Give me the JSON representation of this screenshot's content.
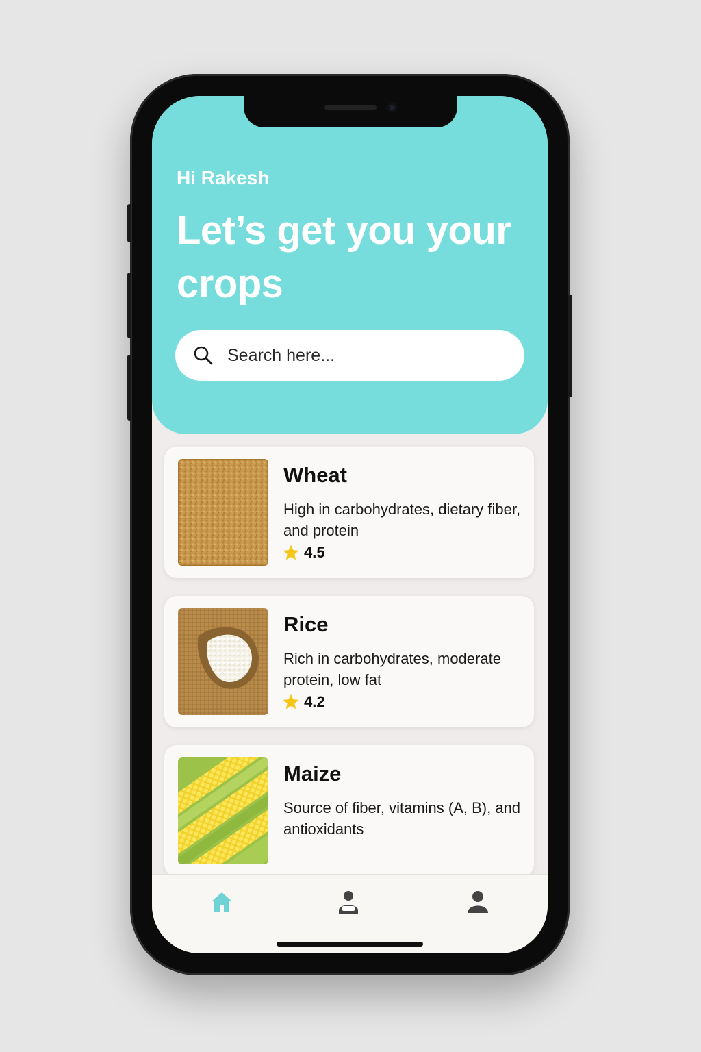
{
  "header": {
    "greeting": "Hi Rakesh",
    "title": "Let’s get you your crops",
    "search_placeholder": "Search here..."
  },
  "crops": [
    {
      "name": "Wheat",
      "description": "High in carbohydrates, dietary fiber, and protein",
      "rating": "4.5",
      "image": "wheat-image"
    },
    {
      "name": "Rice",
      "description": "Rich in carbohydrates, moderate protein, low fat",
      "rating": "4.2",
      "image": "rice-sack-image"
    },
    {
      "name": "Maize",
      "description": "Source of fiber, vitamins (A, B), and antioxidants",
      "image": "maize-cobs-image"
    }
  ],
  "nav": {
    "items": [
      {
        "icon": "home-icon",
        "active": true
      },
      {
        "icon": "farmer-icon",
        "active": false
      },
      {
        "icon": "user-icon",
        "active": false
      }
    ]
  },
  "colors": {
    "header_bg": "#76dcdc",
    "accent": "#6fd3d6",
    "star": "#f5c518",
    "card_bg": "#faf9f7",
    "screen_bg": "#f0ecec"
  }
}
